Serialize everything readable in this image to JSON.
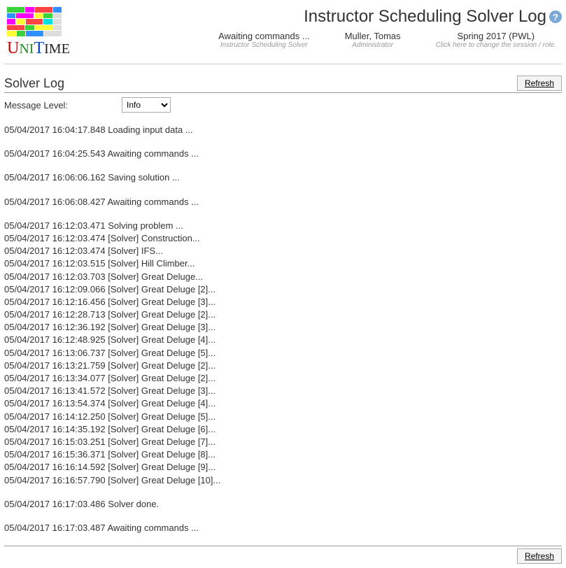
{
  "header": {
    "page_title": "Instructor Scheduling Solver Log",
    "logo_text": "UniTime",
    "status": [
      {
        "main": "Awaiting commands ...",
        "sub": "Instructor Scheduling Solver"
      },
      {
        "main": "Muller, Tomas",
        "sub": "Administrator"
      },
      {
        "main": "Spring 2017 (PWL)",
        "sub": "Click here to change the session / role."
      }
    ]
  },
  "section": {
    "title": "Solver Log",
    "refresh_label": "Refresh",
    "message_level_label": "Message Level:",
    "message_level_value": "Info"
  },
  "log_blocks": [
    [
      {
        "ts": "05/04/2017 16:04:17.848",
        "msg": "Loading input data ..."
      }
    ],
    [
      {
        "ts": "05/04/2017 16:04:25.543",
        "msg": "Awaiting commands ..."
      }
    ],
    [
      {
        "ts": "05/04/2017 16:06:06.162",
        "msg": "Saving solution ..."
      }
    ],
    [
      {
        "ts": "05/04/2017 16:06:08.427",
        "msg": "Awaiting commands ..."
      }
    ],
    [
      {
        "ts": "05/04/2017 16:12:03.471",
        "msg": "Solving problem ..."
      },
      {
        "ts": "05/04/2017 16:12:03.474",
        "msg": "[Solver] Construction..."
      },
      {
        "ts": "05/04/2017 16:12:03.474",
        "msg": "[Solver] IFS..."
      },
      {
        "ts": "05/04/2017 16:12:03.515",
        "msg": "[Solver] Hill Climber..."
      },
      {
        "ts": "05/04/2017 16:12:03.703",
        "msg": "[Solver] Great Deluge..."
      },
      {
        "ts": "05/04/2017 16:12:09.066",
        "msg": "[Solver] Great Deluge [2]..."
      },
      {
        "ts": "05/04/2017 16:12:16.456",
        "msg": "[Solver] Great Deluge [3]..."
      },
      {
        "ts": "05/04/2017 16:12:28.713",
        "msg": "[Solver] Great Deluge [2]..."
      },
      {
        "ts": "05/04/2017 16:12:36.192",
        "msg": "[Solver] Great Deluge [3]..."
      },
      {
        "ts": "05/04/2017 16:12:48.925",
        "msg": "[Solver] Great Deluge [4]..."
      },
      {
        "ts": "05/04/2017 16:13:06.737",
        "msg": "[Solver] Great Deluge [5]..."
      },
      {
        "ts": "05/04/2017 16:13:21.759",
        "msg": "[Solver] Great Deluge [2]..."
      },
      {
        "ts": "05/04/2017 16:13:34.077",
        "msg": "[Solver] Great Deluge [2]..."
      },
      {
        "ts": "05/04/2017 16:13:41.572",
        "msg": "[Solver] Great Deluge [3]..."
      },
      {
        "ts": "05/04/2017 16:13:54.374",
        "msg": "[Solver] Great Deluge [4]..."
      },
      {
        "ts": "05/04/2017 16:14:12.250",
        "msg": "[Solver] Great Deluge [5]..."
      },
      {
        "ts": "05/04/2017 16:14:35.192",
        "msg": "[Solver] Great Deluge [6]..."
      },
      {
        "ts": "05/04/2017 16:15:03.251",
        "msg": "[Solver] Great Deluge [7]..."
      },
      {
        "ts": "05/04/2017 16:15:36.371",
        "msg": "[Solver] Great Deluge [8]..."
      },
      {
        "ts": "05/04/2017 16:16:14.592",
        "msg": "[Solver] Great Deluge [9]..."
      },
      {
        "ts": "05/04/2017 16:16:57.790",
        "msg": "[Solver] Great Deluge [10]..."
      }
    ],
    [
      {
        "ts": "05/04/2017 16:17:03.486",
        "msg": "Solver done."
      }
    ],
    [
      {
        "ts": "05/04/2017 16:17:03.487",
        "msg": "Awaiting commands ..."
      }
    ]
  ]
}
